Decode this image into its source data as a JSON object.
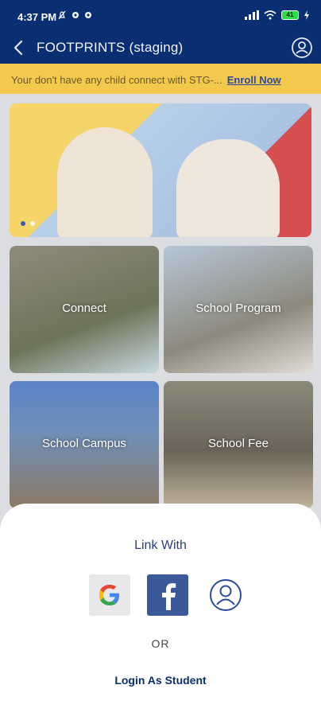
{
  "status_bar": {
    "time": "4:37 PM",
    "battery": "41"
  },
  "app_bar": {
    "title": "FOOTPRINTS (staging)"
  },
  "notice": {
    "message": "Your don't have any child connect with STG-...",
    "link": "Enroll Now"
  },
  "tiles": [
    {
      "label": "Connect"
    },
    {
      "label": "School Program"
    },
    {
      "label": "School Campus"
    },
    {
      "label": "School Fee"
    }
  ],
  "sheet": {
    "title": "Link With",
    "or": "OR",
    "student_login": "Login As Student"
  },
  "icons": [
    "back-arrow-icon",
    "profile-icon",
    "google-icon",
    "facebook-icon",
    "student-profile-icon"
  ],
  "colors": {
    "primary": "#0a2e72",
    "notice": "#f2c94c",
    "facebook": "#3b5998"
  }
}
